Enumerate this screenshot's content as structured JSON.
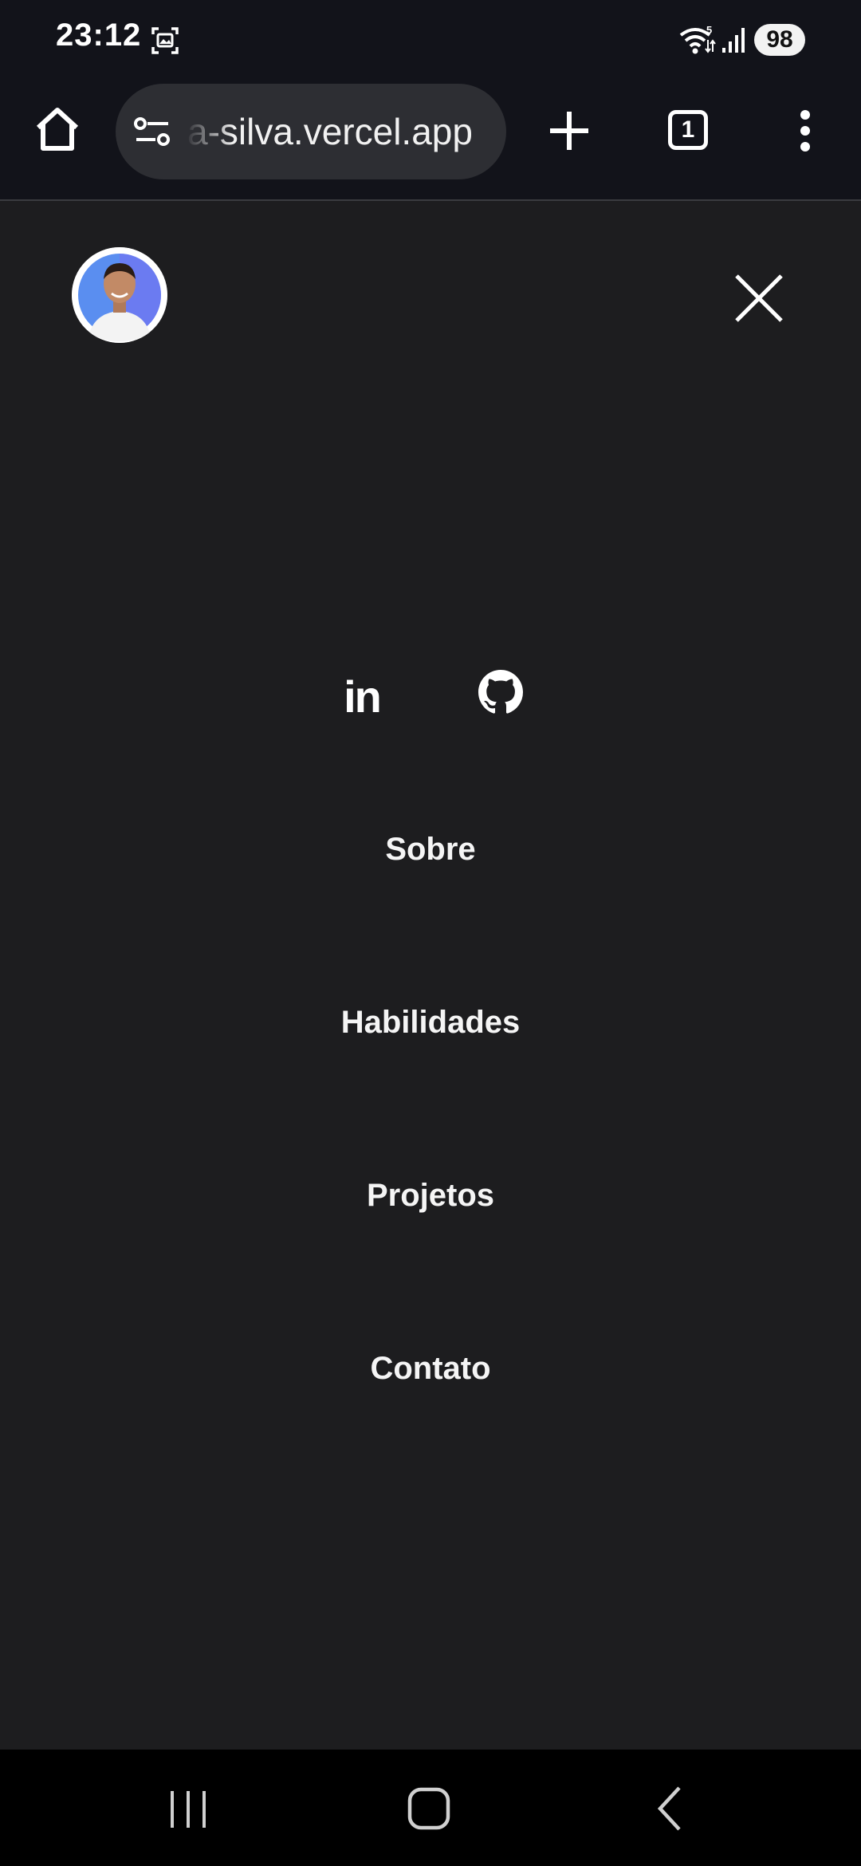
{
  "status_bar": {
    "time": "23:12",
    "battery": "98",
    "icons": [
      "screenshot-icon",
      "wifi-icon",
      "signal-icon"
    ]
  },
  "browser": {
    "url": "a-silva.vercel.app",
    "tab_count": "1",
    "icons": [
      "home-icon",
      "site-settings-icon",
      "plus-icon",
      "more-vert-icon"
    ]
  },
  "menu": {
    "social": {
      "linkedin_label": "in",
      "github_icon": "github-icon"
    },
    "items": [
      {
        "label": "Sobre"
      },
      {
        "label": "Habilidades"
      },
      {
        "label": "Projetos"
      },
      {
        "label": "Contato"
      }
    ]
  },
  "colors": {
    "background": "#1d1d1f",
    "toolbar": "#12131a",
    "url_bar": "#2d2e33",
    "text": "#f5f5f5"
  }
}
